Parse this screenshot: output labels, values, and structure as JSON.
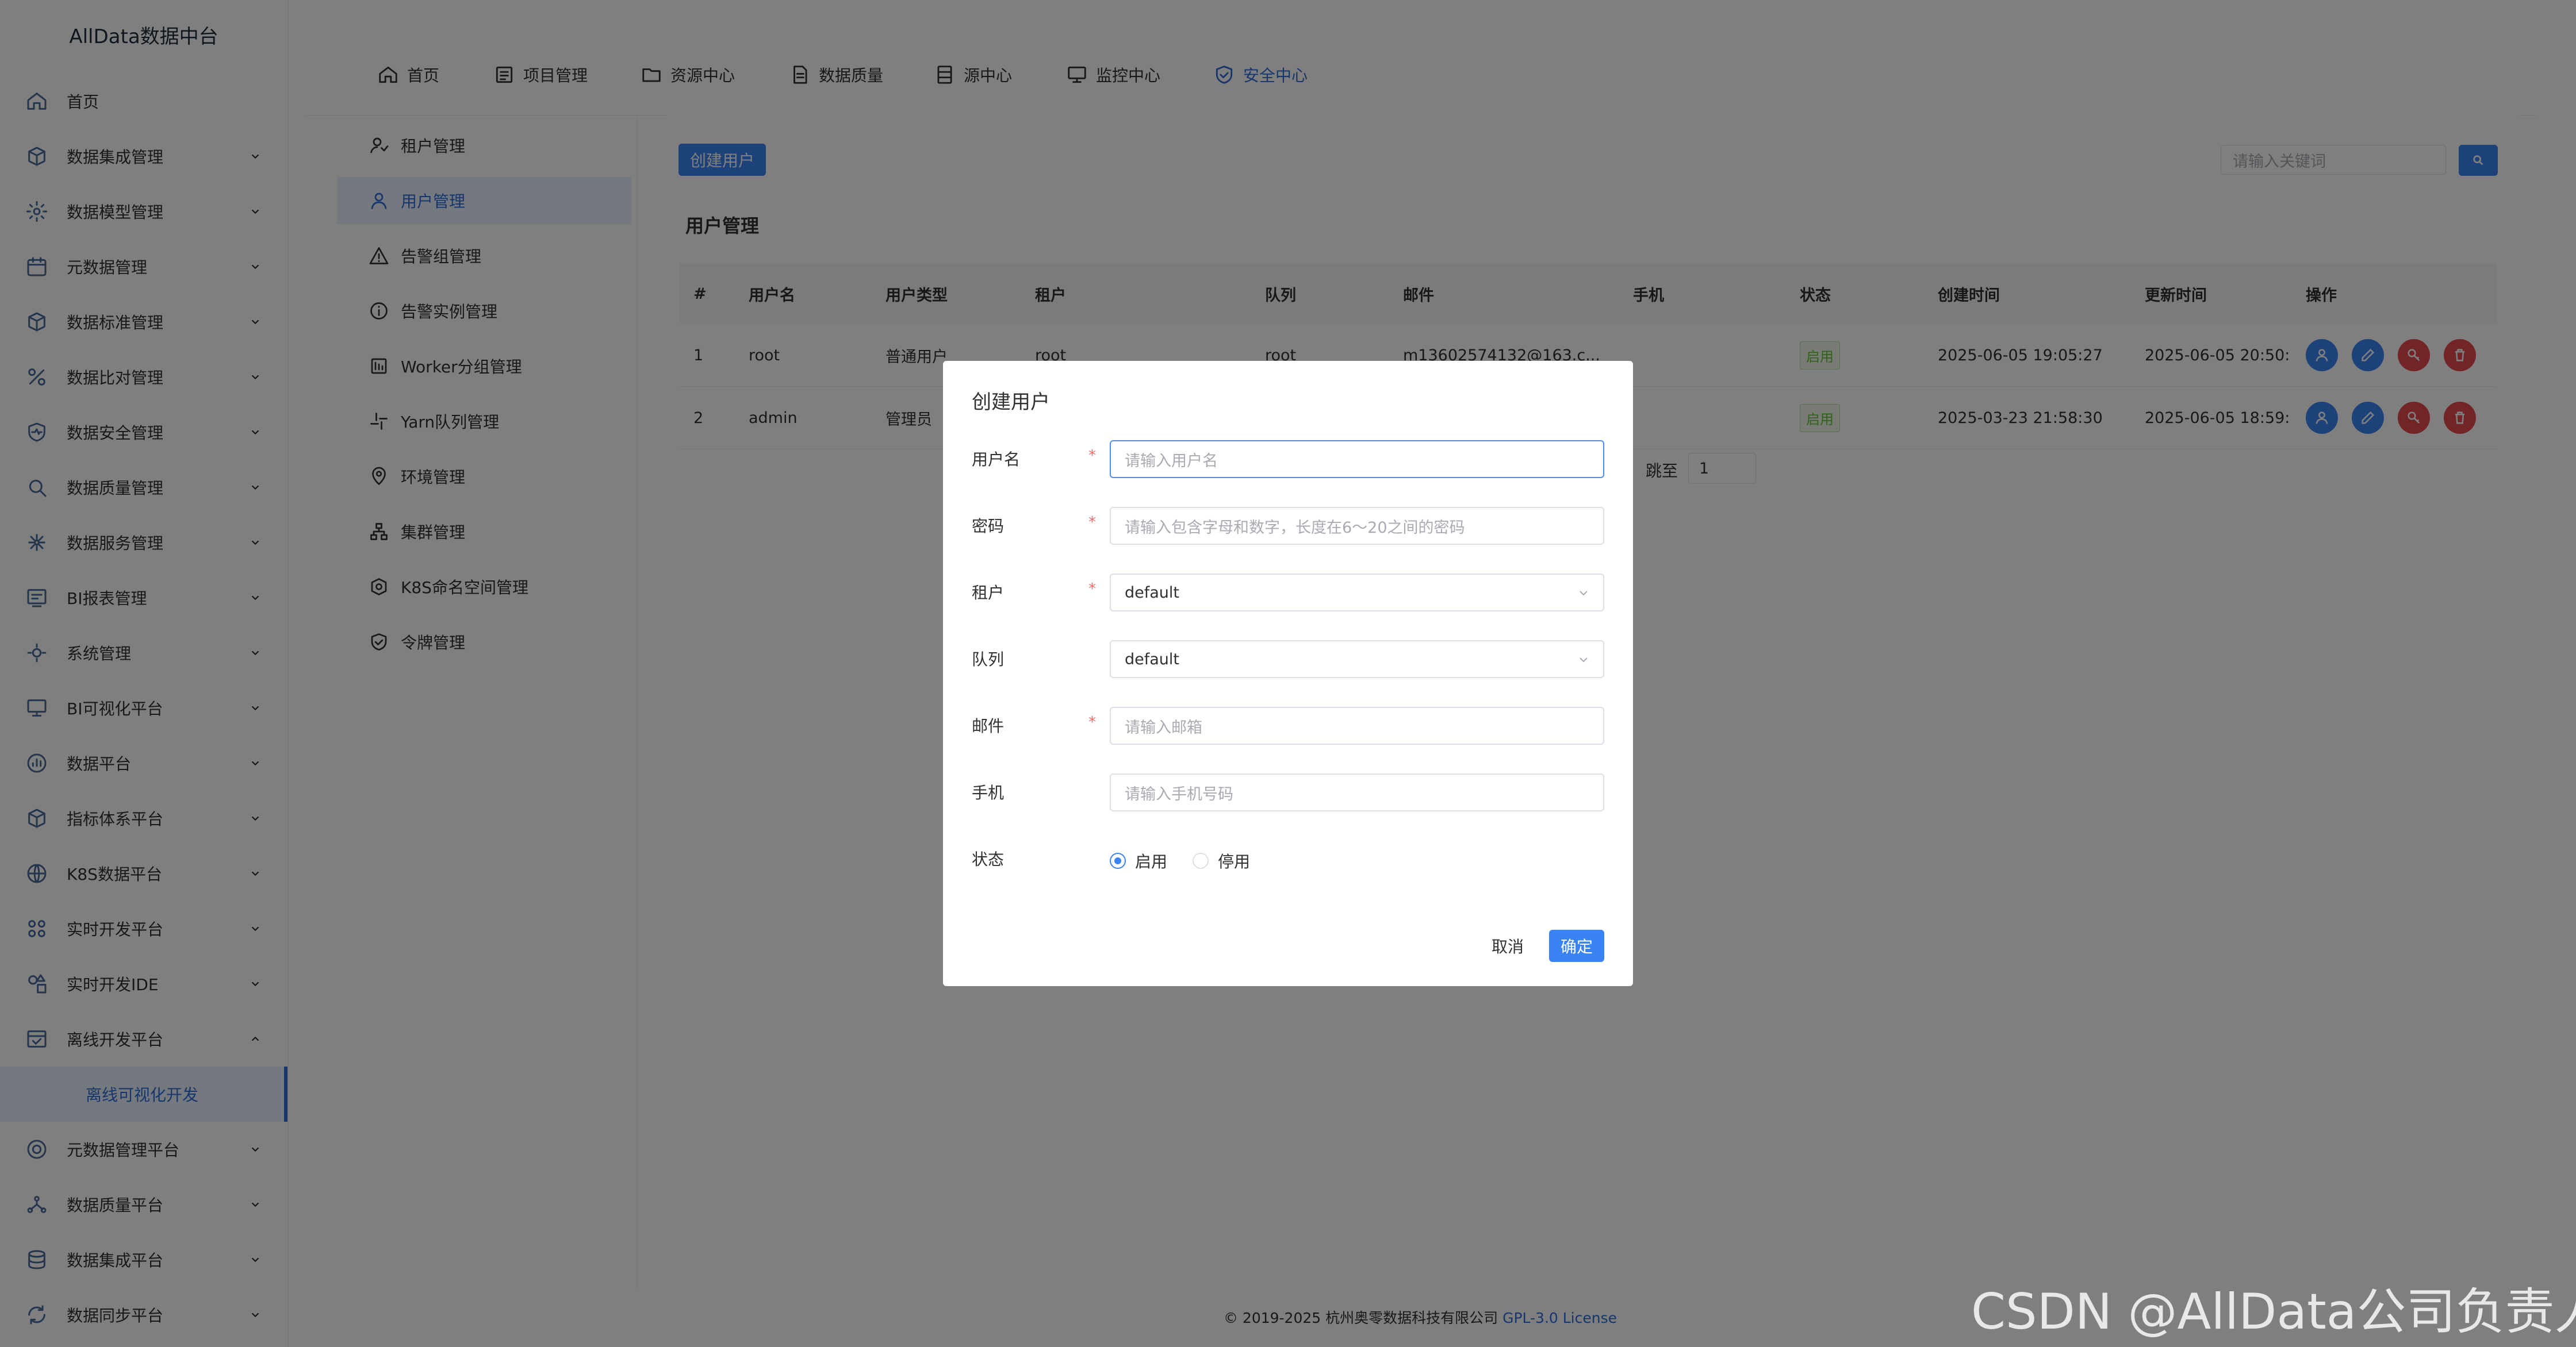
{
  "brand": "AllData数据中台",
  "sidebar": {
    "items": [
      {
        "label": "首页",
        "icon": "home-icon",
        "chevron": false
      },
      {
        "label": "数据集成管理",
        "icon": "box-icon",
        "chevron": true
      },
      {
        "label": "数据模型管理",
        "icon": "gear-icon",
        "chevron": true
      },
      {
        "label": "元数据管理",
        "icon": "calendar-icon",
        "chevron": true
      },
      {
        "label": "数据标准管理",
        "icon": "cube-icon",
        "chevron": true
      },
      {
        "label": "数据比对管理",
        "icon": "percent-icon",
        "chevron": true
      },
      {
        "label": "数据安全管理",
        "icon": "shield-pulse-icon",
        "chevron": true
      },
      {
        "label": "数据质量管理",
        "icon": "search-icon",
        "chevron": true
      },
      {
        "label": "数据服务管理",
        "icon": "network-icon",
        "chevron": true
      },
      {
        "label": "BI报表管理",
        "icon": "report-icon",
        "chevron": true
      },
      {
        "label": "系统管理",
        "icon": "gear-sys-icon",
        "chevron": true
      },
      {
        "label": "BI可视化平台",
        "icon": "monitor-icon",
        "chevron": true
      },
      {
        "label": "数据平台",
        "icon": "chart-circle-icon",
        "chevron": true
      },
      {
        "label": "指标体系平台",
        "icon": "cube-icon",
        "chevron": true
      },
      {
        "label": "K8S数据平台",
        "icon": "globe-icon",
        "chevron": true
      },
      {
        "label": "实时开发平台",
        "icon": "command-icon",
        "chevron": true
      },
      {
        "label": "实时开发IDE",
        "icon": "shapes-icon",
        "chevron": true
      },
      {
        "label": "离线开发平台",
        "icon": "window-icon",
        "chevron": true,
        "expanded": true
      }
    ],
    "active_sub": "离线可视化开发",
    "items_after": [
      {
        "label": "元数据管理平台",
        "icon": "target-icon",
        "chevron": true
      },
      {
        "label": "数据质量平台",
        "icon": "molecule-icon",
        "chevron": true
      },
      {
        "label": "数据集成平台",
        "icon": "database-icon",
        "chevron": true
      },
      {
        "label": "数据同步平台",
        "icon": "sync-icon",
        "chevron": true
      }
    ]
  },
  "topnav": [
    {
      "label": "首页",
      "icon": "home-icon"
    },
    {
      "label": "项目管理",
      "icon": "list-icon"
    },
    {
      "label": "资源中心",
      "icon": "folder-icon"
    },
    {
      "label": "数据质量",
      "icon": "document-icon"
    },
    {
      "label": "源中心",
      "icon": "server-icon"
    },
    {
      "label": "监控中心",
      "icon": "monitor-icon"
    },
    {
      "label": "安全中心",
      "icon": "shield-check-icon",
      "active": true
    }
  ],
  "submenu": [
    {
      "label": "租户管理",
      "icon": "tenant-icon"
    },
    {
      "label": "用户管理",
      "icon": "user-icon",
      "active": true
    },
    {
      "label": "告警组管理",
      "icon": "warning-icon"
    },
    {
      "label": "告警实例管理",
      "icon": "info-icon"
    },
    {
      "label": "Worker分组管理",
      "icon": "worker-icon"
    },
    {
      "label": "Yarn队列管理",
      "icon": "slack-icon"
    },
    {
      "label": "环境管理",
      "icon": "location-icon"
    },
    {
      "label": "集群管理",
      "icon": "cluster-icon"
    },
    {
      "label": "K8S命名空间管理",
      "icon": "k8s-icon"
    },
    {
      "label": "令牌管理",
      "icon": "token-icon"
    }
  ],
  "toolbar": {
    "create_label": "创建用户",
    "search_placeholder": "请输入关键词"
  },
  "section_title": "用户管理",
  "table": {
    "columns": [
      "#",
      "用户名",
      "用户类型",
      "租户",
      "队列",
      "邮件",
      "手机",
      "状态",
      "创建时间",
      "更新时间",
      "操作"
    ],
    "rows": [
      {
        "no": "1",
        "username": "root",
        "type": "普通用户",
        "tenant": "root",
        "queue": "root",
        "email": "m13602574132@163.c...",
        "phone": "",
        "status": "启用",
        "created": "2025-06-05 19:05:27",
        "updated": "2025-06-05 20:50:"
      },
      {
        "no": "2",
        "username": "admin",
        "type": "管理员",
        "tenant": "",
        "queue": "",
        "email": "",
        "phone": "",
        "status": "启用",
        "created": "2025-03-23 21:58:30",
        "updated": "2025-06-05 18:59:"
      }
    ]
  },
  "pagination": {
    "jump_label": "跳至",
    "page": "1"
  },
  "footer": {
    "text": "© 2019-2025 杭州奥零数据科技有限公司",
    "license": "GPL-3.0 License"
  },
  "dialog": {
    "title": "创建用户",
    "fields": {
      "username": {
        "label": "用户名",
        "placeholder": "请输入用户名",
        "required": "*"
      },
      "password": {
        "label": "密码",
        "placeholder": "请输入包含字母和数字，长度在6～20之间的密码",
        "required": "*"
      },
      "tenant": {
        "label": "租户",
        "value": "default",
        "required": "*"
      },
      "queue": {
        "label": "队列",
        "value": "default"
      },
      "email": {
        "label": "邮件",
        "placeholder": "请输入邮箱",
        "required": "*"
      },
      "phone": {
        "label": "手机",
        "placeholder": "请输入手机号码"
      },
      "status": {
        "label": "状态",
        "options": [
          "启用",
          "停用"
        ],
        "selected": "启用"
      }
    },
    "cancel_label": "取消",
    "ok_label": "确定"
  },
  "watermark": "CSDN @AllData公司负责人",
  "colors": {
    "primary": "#3a83f3",
    "success": "#67c23a",
    "danger": "#e5484d",
    "required": "#f56c6c"
  }
}
